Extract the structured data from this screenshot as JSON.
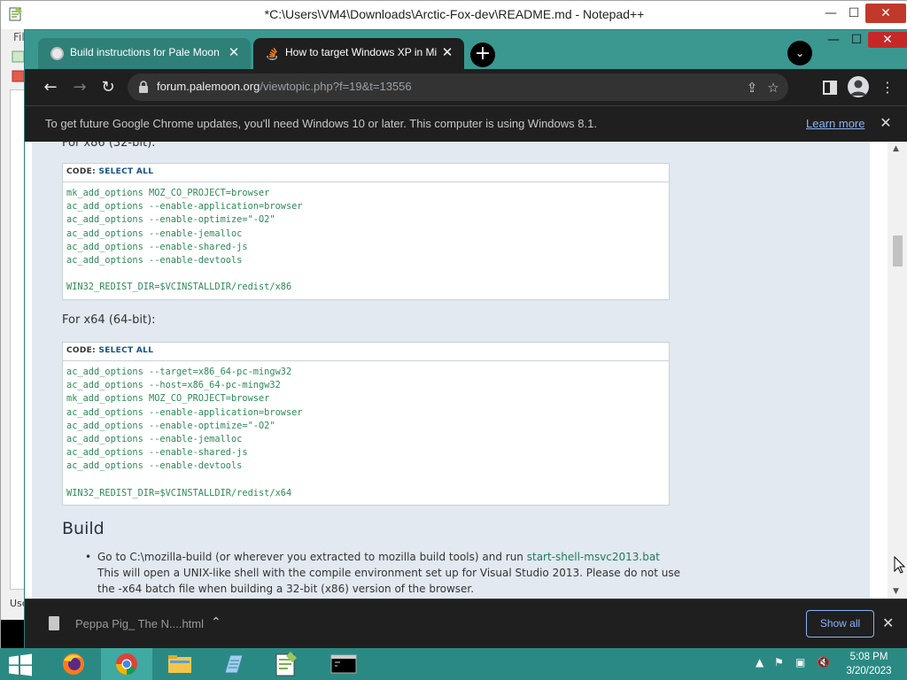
{
  "notepadpp": {
    "title": "*C:\\Users\\VM4\\Downloads\\Arctic-Fox-dev\\README.md - Notepad++",
    "menu_fragment": "Fil",
    "status_fragment": "Use",
    "controls": {
      "minimize": "—",
      "maximize": "☐",
      "close": "✕"
    }
  },
  "chrome": {
    "tabs": [
      {
        "title": "Build instructions for Pale Moon",
        "close": "✕"
      },
      {
        "title": "How to target Windows XP in Mi",
        "close": "✕"
      }
    ],
    "new_tab": "+",
    "tab_search": "⌄",
    "window_controls": {
      "minimize": "—",
      "maximize": "☐",
      "close": "✕"
    },
    "url_host": "forum.palemoon.org",
    "url_path": "/viewtopic.php?f=19&t=13556",
    "infobar": {
      "message": "To get future Google Chrome updates, you'll need Windows 10 or later. This computer is using Windows 8.1.",
      "link": "Learn more",
      "close": "✕"
    },
    "download": {
      "file": "Peppa Pig_ The N....html",
      "show_all": "Show all",
      "close": "✕"
    }
  },
  "page": {
    "x86_label": "For x86 (32-bit):",
    "code_prefix": "CODE: ",
    "code_select": "SELECT ALL",
    "x86_code": [
      "mk_add_options MOZ_CO_PROJECT=browser",
      "ac_add_options --enable-application=browser",
      "ac_add_options --enable-optimize=\"-O2\"",
      "ac_add_options --enable-jemalloc",
      "ac_add_options --enable-shared-js",
      "ac_add_options --enable-devtools",
      "",
      "WIN32_REDIST_DIR=$VCINSTALLDIR/redist/x86"
    ],
    "x64_label": "For x64 (64-bit):",
    "x64_code": [
      "ac_add_options --target=x86_64-pc-mingw32",
      "ac_add_options --host=x86_64-pc-mingw32",
      "mk_add_options MOZ_CO_PROJECT=browser",
      "ac_add_options --enable-application=browser",
      "ac_add_options --enable-optimize=\"-O2\"",
      "ac_add_options --enable-jemalloc",
      "ac_add_options --enable-shared-js",
      "ac_add_options --enable-devtools",
      "",
      "WIN32_REDIST_DIR=$VCINSTALLDIR/redist/x64"
    ],
    "build_heading": "Build",
    "build_step_pre": "Go to C:\\mozilla-build (or wherever you extracted to mozilla build tools) and run ",
    "build_step_link": "start-shell-msvc2013.bat",
    "build_step_line2": "This will open a UNIX-like shell with the compile environment set up for Visual Studio 2013. Please do not use",
    "build_step_line3": "the -x64 batch file when building a 32-bit (x86) version of the browser."
  },
  "taskbar": {
    "time": "5:08 PM",
    "date": "3/20/2023",
    "apps": [
      "firefox-icon",
      "chrome-icon",
      "file-explorer-icon",
      "notepad-icon",
      "notepadpp-icon",
      "cmd-icon"
    ]
  },
  "colors": {
    "desktop_teal": "#3a9891",
    "code_green": "#2e8b57",
    "link_blue": "#8ab4f8",
    "page_bg": "#e2e9f0"
  }
}
